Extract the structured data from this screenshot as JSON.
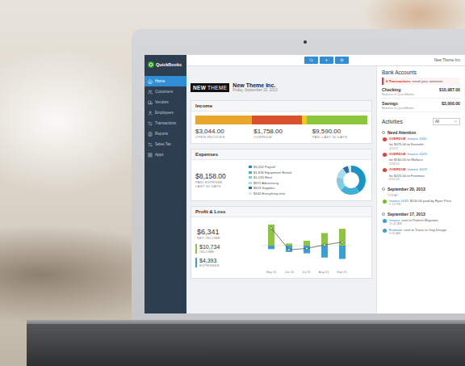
{
  "app": {
    "logo": "QuickBooks",
    "company": "New Theme Inc."
  },
  "sidebar": {
    "items": [
      {
        "label": "Home",
        "selected": true
      },
      {
        "label": "Customers",
        "selected": false
      },
      {
        "label": "Vendors",
        "selected": false
      },
      {
        "label": "Employees",
        "selected": false
      },
      {
        "label": "Transactions",
        "selected": false
      },
      {
        "label": "Reports",
        "selected": false
      },
      {
        "label": "Sales Tax",
        "selected": false
      },
      {
        "label": "Apps",
        "selected": false
      }
    ]
  },
  "header": {
    "logo": [
      "NEW",
      "THEME"
    ],
    "company": "New Theme Inc.",
    "date": "Friday, September 20, 2013"
  },
  "income": {
    "title": "Income",
    "bar": [
      {
        "level": 0.33,
        "color": "#e8a72a"
      },
      {
        "level": 0.29,
        "color": "#d9512c"
      },
      {
        "level": 0.03,
        "color": "#f2c81e"
      },
      {
        "level": 0.35,
        "color": "#8cc63f"
      }
    ],
    "figures": [
      {
        "amount": "$3,044.00",
        "label": "OPEN INVOICES"
      },
      {
        "amount": "$1,758.00",
        "label": "OVERDUE"
      },
      {
        "amount": "$9,590.00",
        "label": "PAID LAST 30 DAYS"
      }
    ]
  },
  "expenses": {
    "title": "Expenses",
    "amount": "$8,158.00",
    "label": "PAID EXPENSE",
    "sublabel": "LAST 30 DAYS",
    "categories": [
      {
        "label": "$3,262 Payroll",
        "value": 3262,
        "color": "#1a94c6"
      },
      {
        "label": "$1,836 Equipment Rental",
        "value": 1836,
        "color": "#3fb0d6"
      },
      {
        "label": "$1,245 Rent",
        "value": 1245,
        "color": "#7fcde3"
      },
      {
        "label": "$972 Advertising",
        "value": 972,
        "color": "#a9dded"
      },
      {
        "label": "$503 Supplies",
        "value": 503,
        "color": "#2a6f9e"
      },
      {
        "label": "$340 Everything else",
        "value": 340,
        "color": "#cfecf5"
      }
    ]
  },
  "profit_loss": {
    "title": "Profit & Loss",
    "net": {
      "amount": "$6,341",
      "label": "NET INCOME"
    },
    "income": {
      "amount": "$10,734",
      "label": "INCOME",
      "color": "#8cc63f"
    },
    "expenses": {
      "amount": "$4,393",
      "label": "EXPENSES",
      "color": "#3a9fd3"
    },
    "chart": {
      "months": [
        "May 13",
        "Jun 13",
        "Jul 13",
        "Aug 13",
        "Sep 13"
      ],
      "income": [
        3000,
        300,
        700,
        1800,
        2400
      ],
      "expenses": [
        500,
        900,
        1100,
        1700,
        1900
      ],
      "net": [
        2500,
        -600,
        -400,
        100,
        500
      ]
    }
  },
  "bank_accounts": {
    "title": "Bank Accounts",
    "alert": {
      "link": "6 Transactions",
      "text": "need your attention"
    },
    "accounts": [
      {
        "name": "Checking",
        "sub": "Balance in QuickBooks",
        "amount": "$10,987.00"
      },
      {
        "name": "Savings",
        "sub": "Balance in QuickBooks",
        "amount": "$3,000.00"
      }
    ]
  },
  "activities": {
    "title": "Activities",
    "filter": "All",
    "groups": [
      {
        "label": "Need Attention",
        "sublabel": "",
        "items": [
          {
            "tag": "OVERDUE",
            "link": "Invoice 1031",
            "text": "for $475.00 to Kenneth",
            "meta": "4/1/13",
            "color": "#e0403a"
          },
          {
            "tag": "OVERDUE",
            "link": "Invoice 1025",
            "text": "for $160.00 to Wallace",
            "meta": "3/28/13",
            "color": "#e0403a"
          },
          {
            "tag": "OVERDUE",
            "link": "Invoice 1019",
            "text": "for $225.00 to Freeman",
            "meta": "3/15/13",
            "color": "#e0403a"
          }
        ]
      },
      {
        "label": "September 20, 2013",
        "sublabel": "TODAY",
        "items": [
          {
            "tag": "",
            "link": "Invoice 1035",
            "text": "$150.00 paid by Ryan Price",
            "meta": "2:13 PM",
            "color": "#7cb82f"
          }
        ]
      },
      {
        "label": "September 17, 2013",
        "sublabel": "",
        "items": [
          {
            "tag": "",
            "link": "Invoice",
            "text": "sent to Pattern Mayrowe",
            "meta": "11:42 AM",
            "color": "#3a9fd3"
          },
          {
            "tag": "",
            "link": "Estimate",
            "text": "sent to Travis in Ong Design",
            "meta": "9:05 AM",
            "color": "#3a9fd3"
          }
        ]
      }
    ]
  }
}
